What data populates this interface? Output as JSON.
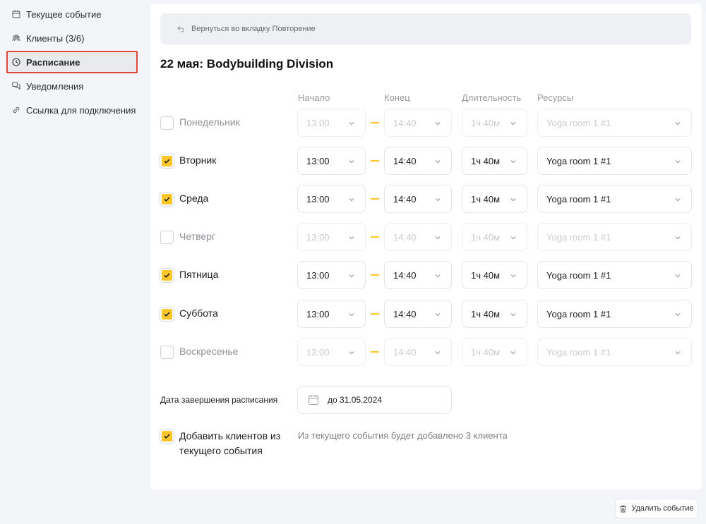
{
  "sidebar": {
    "items": [
      {
        "label": "Текущее событие",
        "icon": "calendar-icon"
      },
      {
        "label": "Клиенты (3/6)",
        "icon": "users-icon"
      },
      {
        "label": "Расписание",
        "icon": "clock-icon",
        "active": true
      },
      {
        "label": "Уведомления",
        "icon": "chat-icon"
      },
      {
        "label": "Ссылка для подключения",
        "icon": "link-icon"
      }
    ]
  },
  "back_link": "Вернуться во вкладку Повторение",
  "title": "22 мая: Bodybuilding Division",
  "columns": {
    "start": "Начало",
    "end": "Конец",
    "duration": "Длительность",
    "resources": "Ресурсы"
  },
  "days": [
    {
      "name": "Понедельник",
      "checked": false,
      "start": "13:00",
      "end": "14:40",
      "duration": "1ч 40м",
      "resource": "Yoga room 1 #1"
    },
    {
      "name": "Вторник",
      "checked": true,
      "start": "13:00",
      "end": "14:40",
      "duration": "1ч 40м",
      "resource": "Yoga room 1 #1"
    },
    {
      "name": "Среда",
      "checked": true,
      "start": "13:00",
      "end": "14:40",
      "duration": "1ч 40м",
      "resource": "Yoga room 1 #1"
    },
    {
      "name": "Четверг",
      "checked": false,
      "start": "13:00",
      "end": "14:40",
      "duration": "1ч 40м",
      "resource": "Yoga room 1 #1"
    },
    {
      "name": "Пятница",
      "checked": true,
      "start": "13:00",
      "end": "14:40",
      "duration": "1ч 40м",
      "resource": "Yoga room 1 #1"
    },
    {
      "name": "Суббота",
      "checked": true,
      "start": "13:00",
      "end": "14:40",
      "duration": "1ч 40м",
      "resource": "Yoga room 1 #1"
    },
    {
      "name": "Воскресенье",
      "checked": false,
      "start": "13:00",
      "end": "14:40",
      "duration": "1ч 40м",
      "resource": "Yoga room 1 #1"
    }
  ],
  "end_date": {
    "label": "Дата завершения расписания",
    "value": "до 31.05.2024"
  },
  "add_clients": {
    "checked": true,
    "label": "Добавить клиентов из текущего события",
    "note": "Из текущего события будет добавлено 3 клиента"
  },
  "delete_button": "Удалить событие",
  "colors": {
    "accent": "#ffc629",
    "highlight": "#e0473b"
  }
}
